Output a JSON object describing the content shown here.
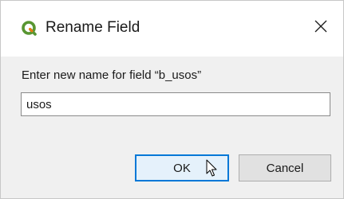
{
  "window": {
    "title": "Rename Field",
    "logo_icon": "qgis-logo-icon",
    "close_icon": "close-icon"
  },
  "dialog": {
    "prompt": "Enter new name for field “b_usos”",
    "name_input_value": "usos"
  },
  "buttons": {
    "ok_label": "OK",
    "cancel_label": "Cancel"
  },
  "colors": {
    "accent": "#0078d7",
    "logo_green": "#589632",
    "logo_yellow": "#ee7913"
  }
}
